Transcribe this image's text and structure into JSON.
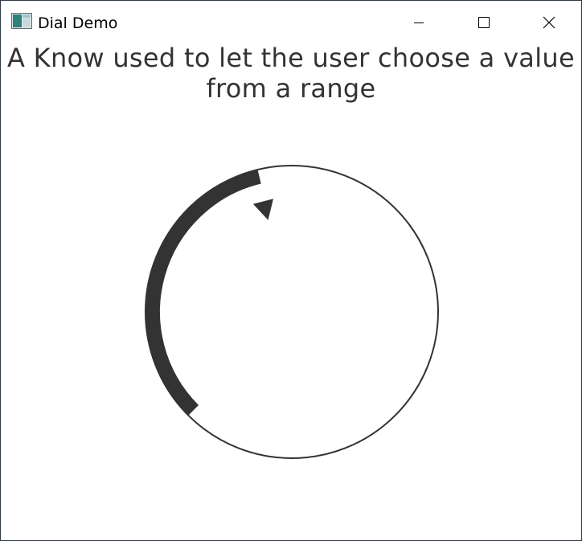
{
  "window": {
    "title": "Dial Demo",
    "icon": "app-window-icon",
    "controls": {
      "minimize_icon": "minimize-icon",
      "maximize_icon": "maximize-icon",
      "close_icon": "close-icon"
    }
  },
  "content": {
    "heading": "A Know used to let the user choose a value from a range"
  },
  "dial": {
    "value_fraction": 0.45,
    "colors": {
      "track": "#333333",
      "indicator": "#333333",
      "background": "#ffffff"
    },
    "indicator_icon": "triangle-pointer-icon"
  }
}
